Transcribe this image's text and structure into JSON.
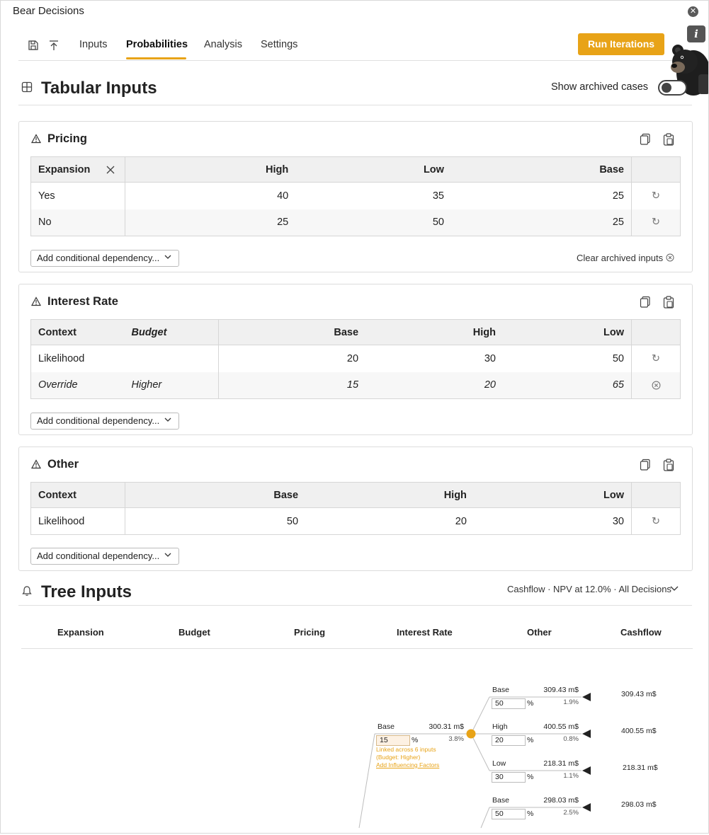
{
  "app": {
    "title": "Bear Decisions"
  },
  "toolbar": {
    "tabs": [
      {
        "label": "Inputs"
      },
      {
        "label": "Probabilities"
      },
      {
        "label": "Analysis"
      },
      {
        "label": "Settings"
      }
    ],
    "active_tab": "Probabilities",
    "run_label": "Run Iterations",
    "info_label": "i"
  },
  "tabular": {
    "title": "Tabular Inputs",
    "toggle_label": "Show archived cases"
  },
  "pricing": {
    "title": "Pricing",
    "headers": [
      "Expansion",
      "High",
      "Low",
      "Base"
    ],
    "rows": [
      {
        "label": "Yes",
        "values": [
          "40",
          "35",
          "25"
        ]
      },
      {
        "label": "No",
        "values": [
          "25",
          "50",
          "25"
        ]
      }
    ],
    "dep_label": "Add conditional dependency...",
    "clear_label": "Clear archived inputs"
  },
  "interest": {
    "title": "Interest Rate",
    "headers": [
      "Context",
      "Budget",
      "Base",
      "High",
      "Low"
    ],
    "rows": [
      {
        "label": "Likelihood",
        "sub": "",
        "values": [
          "20",
          "30",
          "50"
        ]
      },
      {
        "label": "Override",
        "sub": "Higher",
        "values": [
          "15",
          "20",
          "65"
        ]
      }
    ],
    "dep_label": "Add conditional dependency..."
  },
  "other": {
    "title": "Other",
    "headers": [
      "Context",
      "Base",
      "High",
      "Low"
    ],
    "rows": [
      {
        "label": "Likelihood",
        "values": [
          "50",
          "20",
          "30"
        ]
      }
    ],
    "dep_label": "Add conditional dependency..."
  },
  "tree": {
    "title": "Tree Inputs",
    "selector": "Cashflow · NPV at 12.0% · All Decisions",
    "columns": [
      "Expansion",
      "Budget",
      "Pricing",
      "Interest Rate",
      "Other",
      "Cashflow"
    ],
    "parent": {
      "label": "Base",
      "value": "300.31 m$",
      "input": "15",
      "pct": "3.8%",
      "linked_line1": "Linked across 6 inputs",
      "linked_line2": "(Budget: Higher)",
      "linked_link": "Add Influencing Factors"
    },
    "children": [
      {
        "label": "Base",
        "value": "309.43 m$",
        "input": "50",
        "pct": "1.9%",
        "end": "309.43 m$"
      },
      {
        "label": "High",
        "value": "400.55 m$",
        "input": "20",
        "pct": "0.8%",
        "end": "400.55 m$"
      },
      {
        "label": "Low",
        "value": "218.31 m$",
        "input": "30",
        "pct": "1.1%",
        "end": "218.31 m$"
      },
      {
        "label": "Base",
        "value": "298.03 m$",
        "input": "50",
        "pct": "2.5%",
        "end": "298.03 m$"
      }
    ],
    "percent_sign": "%"
  },
  "colors": {
    "accent": "#e8a317",
    "border": "#dcdcdc",
    "header_bg": "#f0f0f0"
  },
  "icons": [
    "save-icon",
    "upload-icon",
    "close-icon",
    "grid-icon",
    "warning-icon",
    "copy-icon",
    "paste-icon",
    "reset-icon",
    "clear-icon",
    "chevron-down-icon",
    "bell-icon",
    "bear-mascot-icon"
  ]
}
